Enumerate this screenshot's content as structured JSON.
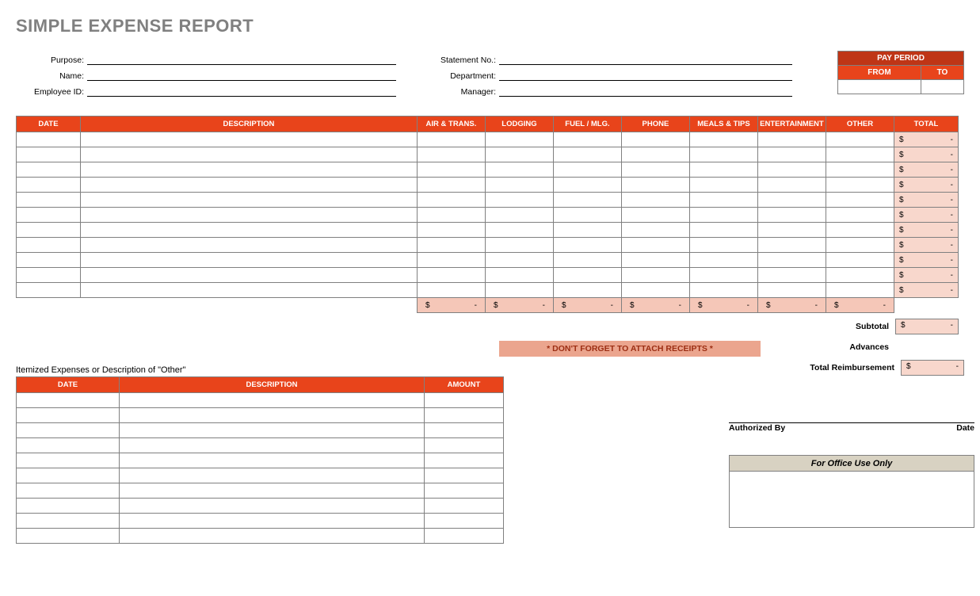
{
  "title": "SIMPLE EXPENSE REPORT",
  "meta": {
    "purpose_label": "Purpose:",
    "name_label": "Name:",
    "employee_id_label": "Employee ID:",
    "statement_no_label": "Statement No.:",
    "department_label": "Department:",
    "manager_label": "Manager:",
    "purpose": "",
    "name": "",
    "employee_id": "",
    "statement_no": "",
    "department": "",
    "manager": ""
  },
  "pay_period": {
    "heading": "PAY PERIOD",
    "from_label": "FROM",
    "to_label": "TO",
    "from": "",
    "to": ""
  },
  "main_table": {
    "headers": {
      "date": "DATE",
      "description": "DESCRIPTION",
      "air_trans": "AIR & TRANS.",
      "lodging": "LODGING",
      "fuel_mlg": "FUEL / MLG.",
      "phone": "PHONE",
      "meals_tips": "MEALS & TIPS",
      "entertainment": "ENTERTAINMENT",
      "other": "OTHER",
      "total": "TOTAL"
    },
    "rows": [
      {
        "date": "",
        "description": "",
        "air_trans": "",
        "lodging": "",
        "fuel_mlg": "",
        "phone": "",
        "meals_tips": "",
        "entertainment": "",
        "other": "",
        "total_currency": "$",
        "total_value": "-"
      },
      {
        "date": "",
        "description": "",
        "air_trans": "",
        "lodging": "",
        "fuel_mlg": "",
        "phone": "",
        "meals_tips": "",
        "entertainment": "",
        "other": "",
        "total_currency": "$",
        "total_value": "-"
      },
      {
        "date": "",
        "description": "",
        "air_trans": "",
        "lodging": "",
        "fuel_mlg": "",
        "phone": "",
        "meals_tips": "",
        "entertainment": "",
        "other": "",
        "total_currency": "$",
        "total_value": "-"
      },
      {
        "date": "",
        "description": "",
        "air_trans": "",
        "lodging": "",
        "fuel_mlg": "",
        "phone": "",
        "meals_tips": "",
        "entertainment": "",
        "other": "",
        "total_currency": "$",
        "total_value": "-"
      },
      {
        "date": "",
        "description": "",
        "air_trans": "",
        "lodging": "",
        "fuel_mlg": "",
        "phone": "",
        "meals_tips": "",
        "entertainment": "",
        "other": "",
        "total_currency": "$",
        "total_value": "-"
      },
      {
        "date": "",
        "description": "",
        "air_trans": "",
        "lodging": "",
        "fuel_mlg": "",
        "phone": "",
        "meals_tips": "",
        "entertainment": "",
        "other": "",
        "total_currency": "$",
        "total_value": "-"
      },
      {
        "date": "",
        "description": "",
        "air_trans": "",
        "lodging": "",
        "fuel_mlg": "",
        "phone": "",
        "meals_tips": "",
        "entertainment": "",
        "other": "",
        "total_currency": "$",
        "total_value": "-"
      },
      {
        "date": "",
        "description": "",
        "air_trans": "",
        "lodging": "",
        "fuel_mlg": "",
        "phone": "",
        "meals_tips": "",
        "entertainment": "",
        "other": "",
        "total_currency": "$",
        "total_value": "-"
      },
      {
        "date": "",
        "description": "",
        "air_trans": "",
        "lodging": "",
        "fuel_mlg": "",
        "phone": "",
        "meals_tips": "",
        "entertainment": "",
        "other": "",
        "total_currency": "$",
        "total_value": "-"
      },
      {
        "date": "",
        "description": "",
        "air_trans": "",
        "lodging": "",
        "fuel_mlg": "",
        "phone": "",
        "meals_tips": "",
        "entertainment": "",
        "other": "",
        "total_currency": "$",
        "total_value": "-"
      },
      {
        "date": "",
        "description": "",
        "air_trans": "",
        "lodging": "",
        "fuel_mlg": "",
        "phone": "",
        "meals_tips": "",
        "entertainment": "",
        "other": "",
        "total_currency": "$",
        "total_value": "-"
      }
    ],
    "column_sums": [
      {
        "currency": "$",
        "value": "-"
      },
      {
        "currency": "$",
        "value": "-"
      },
      {
        "currency": "$",
        "value": "-"
      },
      {
        "currency": "$",
        "value": "-"
      },
      {
        "currency": "$",
        "value": "-"
      },
      {
        "currency": "$",
        "value": "-"
      },
      {
        "currency": "$",
        "value": "-"
      }
    ]
  },
  "receipts_notice": "* DON'T FORGET TO ATTACH RECEIPTS *",
  "summary": {
    "subtotal_label": "Subtotal",
    "subtotal_currency": "$",
    "subtotal_value": "-",
    "advances_label": "Advances",
    "advances_value": "",
    "total_label": "Total Reimbursement",
    "total_currency": "$",
    "total_value": "-"
  },
  "itemized": {
    "title": "Itemized Expenses or Description of \"Other\"",
    "headers": {
      "date": "DATE",
      "description": "DESCRIPTION",
      "amount": "AMOUNT"
    },
    "rows": [
      {
        "date": "",
        "description": "",
        "amount": ""
      },
      {
        "date": "",
        "description": "",
        "amount": ""
      },
      {
        "date": "",
        "description": "",
        "amount": ""
      },
      {
        "date": "",
        "description": "",
        "amount": ""
      },
      {
        "date": "",
        "description": "",
        "amount": ""
      },
      {
        "date": "",
        "description": "",
        "amount": ""
      },
      {
        "date": "",
        "description": "",
        "amount": ""
      },
      {
        "date": "",
        "description": "",
        "amount": ""
      },
      {
        "date": "",
        "description": "",
        "amount": ""
      },
      {
        "date": "",
        "description": "",
        "amount": ""
      }
    ]
  },
  "signoff": {
    "authorized_by_label": "Authorized By",
    "date_label": "Date",
    "office_use_label": "For Office Use Only"
  }
}
